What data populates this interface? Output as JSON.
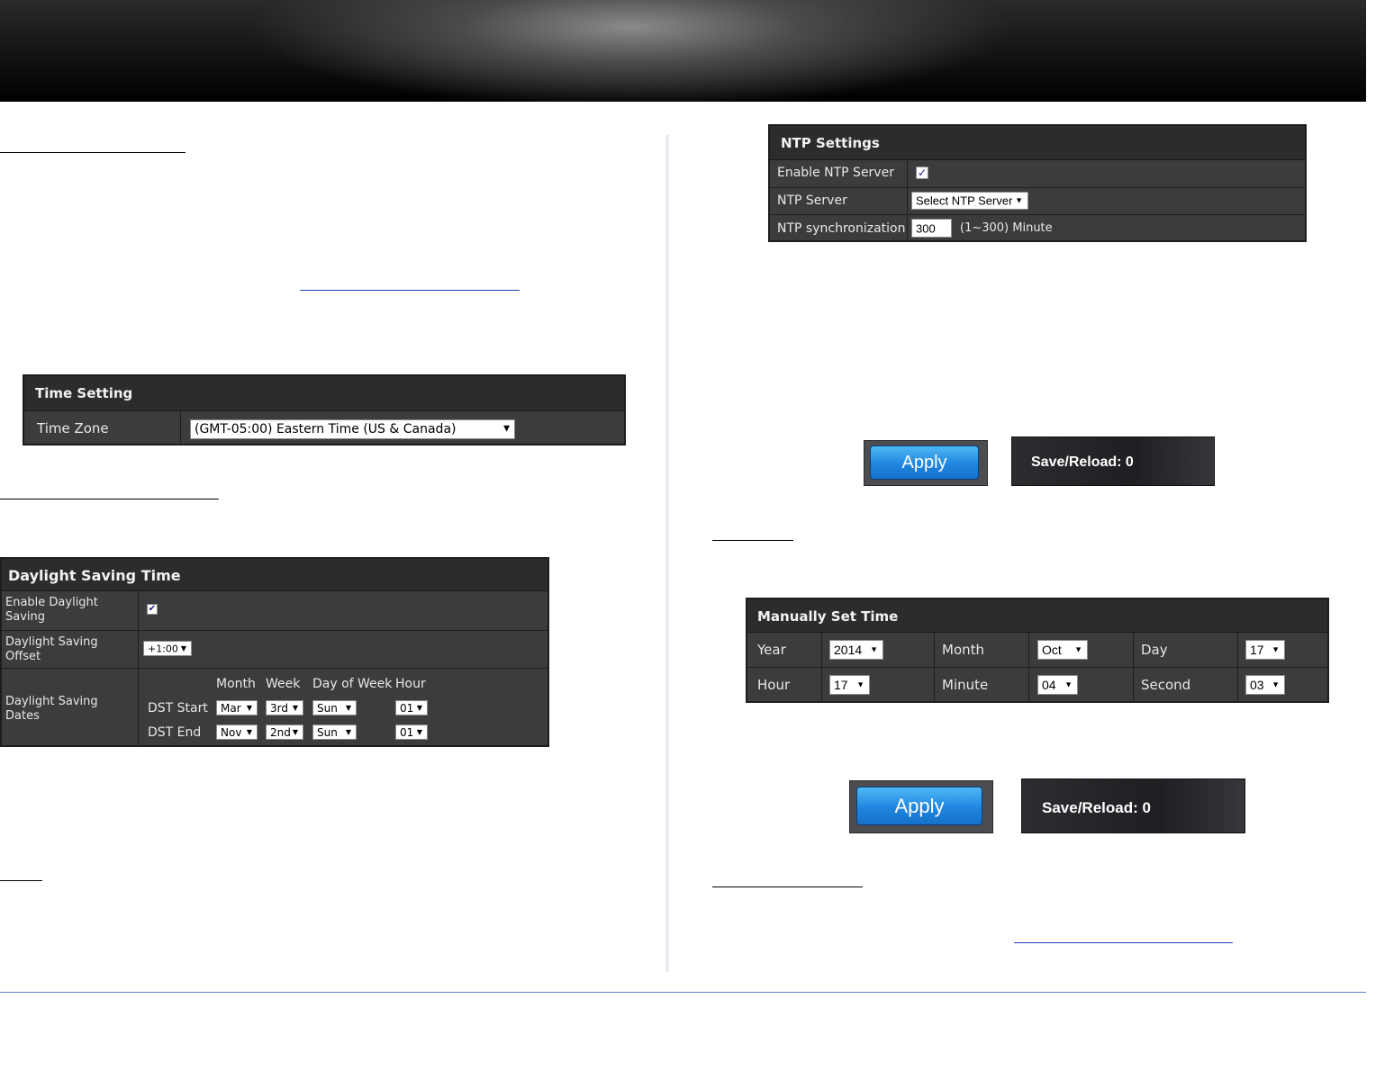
{
  "time_setting": {
    "title": "Time Setting",
    "time_zone_label": "Time Zone",
    "time_zone_value": "(GMT-05:00) Eastern Time (US & Canada)"
  },
  "dst": {
    "title": "Daylight Saving Time",
    "enable_label_1": "Enable Daylight",
    "enable_label_2": "Saving",
    "enable_checked": "✔",
    "offset_label_1": "Daylight Saving",
    "offset_label_2": "Offset",
    "offset_value": "+1:00",
    "dates_label_1": "Daylight Saving",
    "dates_label_2": "Dates",
    "col_month": "Month",
    "col_week": "Week",
    "col_dow": "Day of Week",
    "col_hour": "Hour",
    "start_label": "DST Start",
    "start_month": "Mar",
    "start_week": "3rd",
    "start_dow": "Sun",
    "start_hour": "01",
    "end_label": "DST End",
    "end_month": "Nov",
    "end_week": "2nd",
    "end_dow": "Sun",
    "end_hour": "01"
  },
  "ntp": {
    "title": "NTP Settings",
    "enable_label": "Enable NTP Server",
    "enable_checked": "✓",
    "server_label": "NTP Server",
    "server_value": "Select NTP Server",
    "sync_label": "NTP synchronization",
    "sync_value": "300",
    "sync_unit": "(1~300) Minute"
  },
  "buttons": {
    "apply": "Apply",
    "save_reload": "Save/Reload: 0"
  },
  "manual": {
    "title": "Manually Set Time",
    "year_label": "Year",
    "year_value": "2014",
    "month_label": "Month",
    "month_value": "Oct",
    "day_label": "Day",
    "day_value": "17",
    "hour_label": "Hour",
    "hour_value": "17",
    "minute_label": "Minute",
    "minute_value": "04",
    "second_label": "Second",
    "second_value": "03"
  }
}
